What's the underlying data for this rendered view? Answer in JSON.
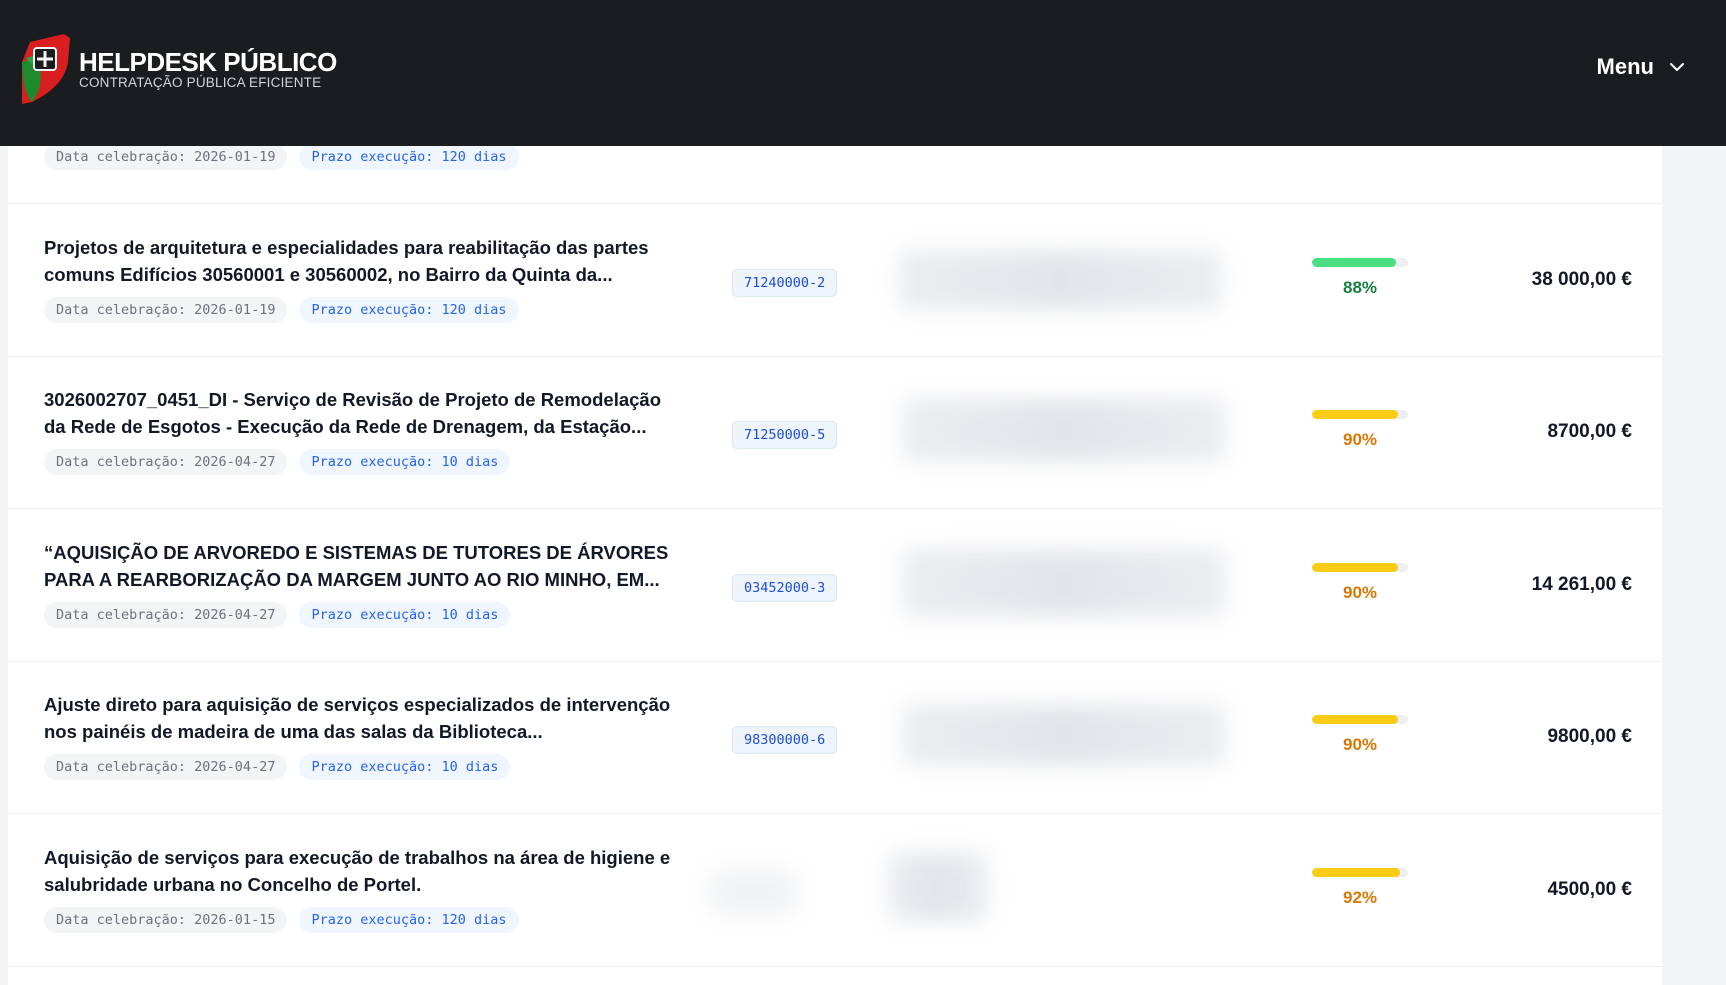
{
  "header": {
    "brand_title": "HELPDESK PÚBLICO",
    "brand_subtitle": "CONTRATAÇÃO PÚBLICA EFICIENTE",
    "menu_label": "Menu"
  },
  "colors": {
    "header_bg": "#1b1c20",
    "progress_green": "#4ade80",
    "progress_yellow": "#facc15",
    "pct_green": "#15803d",
    "pct_orange": "#d97706"
  },
  "contracts": [
    {
      "title": "",
      "date_chip": "Data celebração: 2026-01-19",
      "prazo_chip": "Prazo execução: 120 dias"
    },
    {
      "title": "Projetos de arquitetura e especialidades para reabilitação das partes comuns Edifícios 30560001 e 30560002, no Bairro da Quinta da...",
      "date_chip": "Data celebração: 2026-01-19",
      "prazo_chip": "Prazo execução: 120 dias",
      "cpv": "71240000-2",
      "score": 0.88,
      "score_label": "88%",
      "amount": "38 000,00 €"
    },
    {
      "title": "3026002707_0451_DI - Serviço de Revisão de Projeto de Remodelação da Rede de Esgotos - Execução da Rede de Drenagem, da Estação...",
      "date_chip": "Data celebração: 2026-04-27",
      "prazo_chip": "Prazo execução: 10 dias",
      "cpv": "71250000-5",
      "score": 0.9,
      "score_label": "90%",
      "amount": "8700,00 €"
    },
    {
      "title": "“AQUISIÇÃO DE ARVOREDO E SISTEMAS DE TUTORES DE ÁRVORES PARA A REARBORIZAÇÃO DA MARGEM JUNTO AO RIO MINHO, EM...",
      "date_chip": "Data celebração: 2026-04-27",
      "prazo_chip": "Prazo execução: 10 dias",
      "cpv": "03452000-3",
      "score": 0.9,
      "score_label": "90%",
      "amount": "14 261,00 €"
    },
    {
      "title": "Ajuste direto para aquisição de serviços especializados de intervenção nos painéis de madeira de uma das salas da Biblioteca...",
      "date_chip": "Data celebração: 2026-04-27",
      "prazo_chip": "Prazo execução: 10 dias",
      "cpv": "98300000-6",
      "score": 0.9,
      "score_label": "90%",
      "amount": "9800,00 €"
    },
    {
      "title": "Aquisição de serviços para execução de trabalhos na área de higiene e salubridade urbana no Concelho de Portel.",
      "date_chip": "Data celebração: 2026-01-15",
      "prazo_chip": "Prazo execução: 120 dias",
      "score": 0.92,
      "score_label": "92%",
      "amount": "4500,00 €"
    }
  ]
}
